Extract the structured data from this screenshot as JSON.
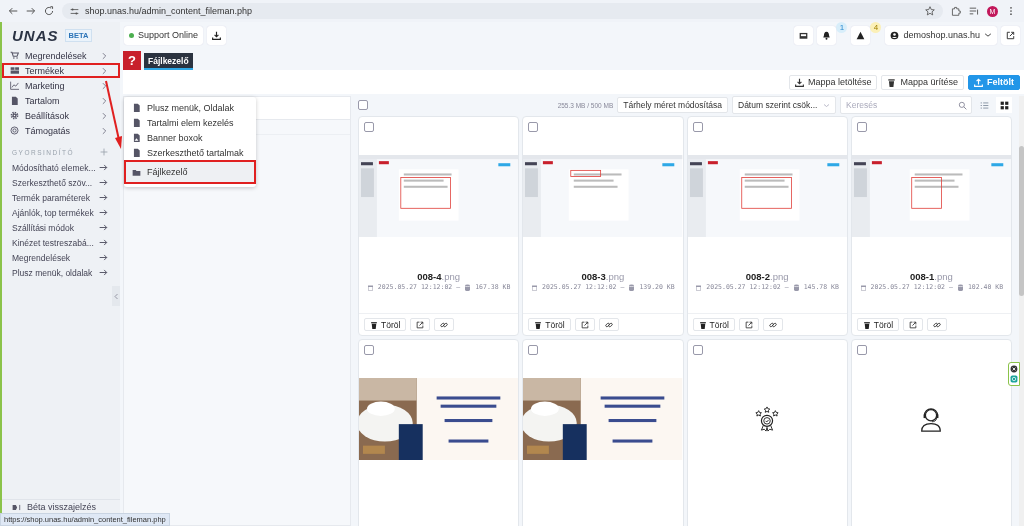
{
  "browser": {
    "url": "shop.unas.hu/admin_content_fileman.php",
    "avatar": "M"
  },
  "sidebar": {
    "logo": "UNAS",
    "badge": "BETA",
    "menu": [
      {
        "label": "Megrendelések",
        "annotated": false
      },
      {
        "label": "Termékek",
        "annotated": true
      },
      {
        "label": "Marketing",
        "annotated": false
      },
      {
        "label": "Tartalom",
        "annotated": false
      },
      {
        "label": "Beállítások",
        "annotated": false
      },
      {
        "label": "Támogatás",
        "annotated": false
      }
    ],
    "quick_title": "GYORSINDÍTÓ",
    "quick": [
      "Módosítható elemek...",
      "Szerkeszthető szöv...",
      "Termék paraméterek",
      "Ajánlók, top termékek",
      "Szállítási módok",
      "Kinézet testreszabá...",
      "Megrendelések",
      "Plusz menük, oldalak"
    ],
    "feedback": "Béta visszajelzés"
  },
  "submenu": [
    {
      "label": "Plusz menük, Oldalak",
      "selected": false,
      "annotated": false
    },
    {
      "label": "Tartalmi elem kezelés",
      "selected": false,
      "annotated": false
    },
    {
      "label": "Banner boxok",
      "selected": false,
      "annotated": false
    },
    {
      "label": "Szerkeszthető tartalmak",
      "selected": false,
      "annotated": false
    },
    {
      "label": "Fájlkezelő",
      "selected": true,
      "annotated": true
    }
  ],
  "header": {
    "support": "Support Online",
    "online": true,
    "notifications": "1",
    "warnings": "4",
    "account": "demoshop.unas.hu"
  },
  "help": "?",
  "tabs": [
    {
      "label": "Fájlkezelő",
      "selected": true
    }
  ],
  "actions": [
    {
      "label": "Mappa letöltése",
      "kind": "download"
    },
    {
      "label": "Mappa ürítése",
      "kind": "trash"
    },
    {
      "label": "Feltölt",
      "kind": "upload"
    }
  ],
  "filebar": {
    "select_all_checked": false,
    "usage": "255.3 MB / 500 MB",
    "resize": "Tárhely méret módosítása",
    "sort": "Dátum szerint csök...",
    "search_placeholder": "Keresés",
    "views": [
      {
        "kind": "list",
        "selected": false
      },
      {
        "kind": "grid",
        "selected": true
      }
    ]
  },
  "files": [
    {
      "kind": "screenshot",
      "checked": false,
      "name": "008-4",
      "ext": ".png",
      "date": "2025.05.27 12:12:02",
      "sep": "–",
      "size": "167.38 KB",
      "delete": "Töröl"
    },
    {
      "kind": "screenshot",
      "checked": false,
      "name": "008-3",
      "ext": ".png",
      "date": "2025.05.27 12:12:02",
      "sep": "–",
      "size": "139.20 KB",
      "delete": "Töröl"
    },
    {
      "kind": "screenshot",
      "checked": false,
      "name": "008-2",
      "ext": ".png",
      "date": "2025.05.27 12:12:02",
      "sep": "–",
      "size": "145.78 KB",
      "delete": "Töröl"
    },
    {
      "kind": "screenshot",
      "checked": false,
      "name": "008-1",
      "ext": ".png",
      "date": "2025.05.27 12:12:02",
      "sep": "–",
      "size": "102.40 KB",
      "delete": "Töröl"
    },
    {
      "kind": "banner",
      "checked": false
    },
    {
      "kind": "banner",
      "checked": false
    },
    {
      "kind": "award",
      "checked": false
    },
    {
      "kind": "support",
      "checked": false
    }
  ],
  "status_url": "https://shop.unas.hu/admin_content_fileman.php"
}
